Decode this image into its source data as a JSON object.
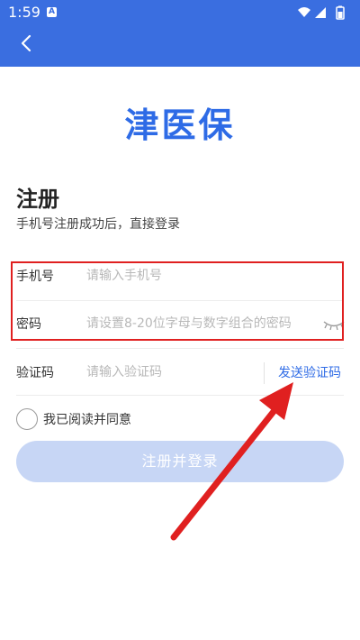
{
  "status_bar": {
    "time": "1:59",
    "notification": "A"
  },
  "app": {
    "brand": "津医保"
  },
  "page": {
    "title": "注册",
    "subtitle": "手机号注册成功后，直接登录"
  },
  "form": {
    "phone": {
      "label": "手机号",
      "placeholder": "请输入手机号"
    },
    "password": {
      "label": "密码",
      "placeholder": "请设置8-20位字母与数字组合的密码"
    },
    "code": {
      "label": "验证码",
      "placeholder": "请输入验证码",
      "send_label": "发送验证码"
    },
    "agreement": {
      "label": "我已阅读并同意"
    },
    "submit_label": "注册并登录"
  },
  "colors": {
    "header": "#3a6ee0",
    "brand": "#2e6be6",
    "button_disabled": "#c7d6f5",
    "annotation": "#e02020"
  }
}
